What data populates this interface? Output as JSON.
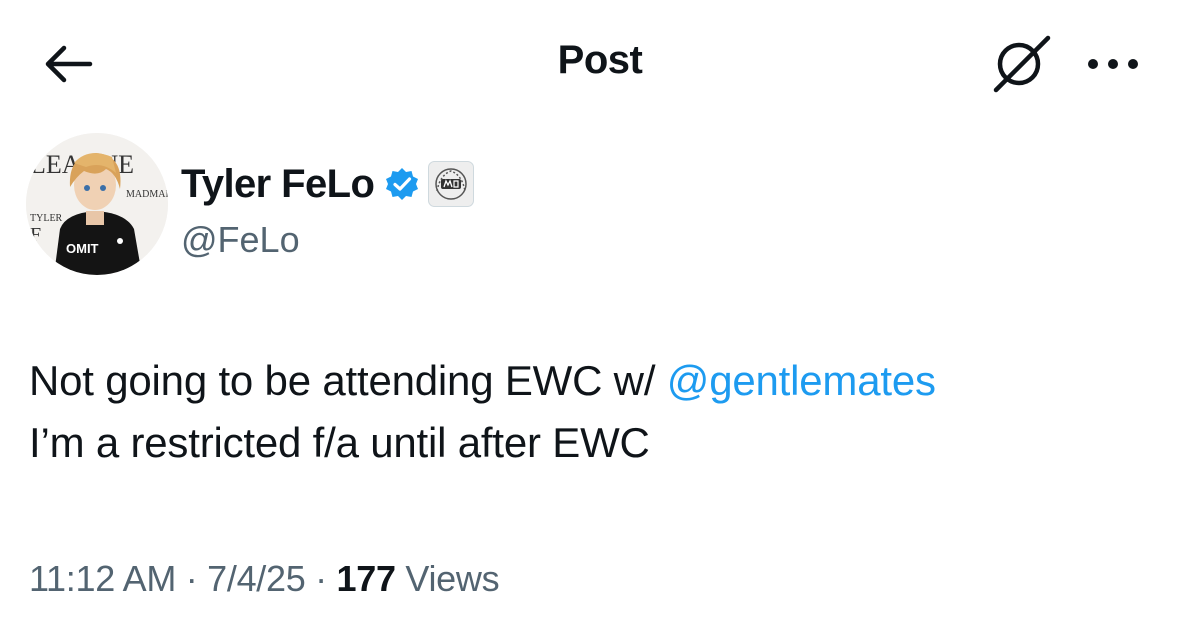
{
  "header": {
    "back_icon": "arrow-left-icon",
    "title": "Post",
    "grok_icon": "grok-icon",
    "more_icon": "more-horizontal-icon"
  },
  "author": {
    "display_name": "Tyler FeLo",
    "handle": "@FeLo",
    "verified_icon": "verified-badge-icon",
    "affiliation_badge": "team-affiliation-badge",
    "avatar_text": {
      "banner": "LEAGUE",
      "jacket": "OMIT",
      "side": "TYLER",
      "letter": "F",
      "sign": "MADMAR"
    }
  },
  "tweet": {
    "text_before_mention": "Not going to be attending EWC w/ ",
    "mention": "@gentlemates",
    "text_line2": "I’m a restricted f/a until after EWC"
  },
  "meta": {
    "time": "11:12 AM",
    "separator": " · ",
    "date": "7/4/25",
    "views_count": "177",
    "views_label": " Views"
  },
  "colors": {
    "text": "#0f1419",
    "secondary": "#536471",
    "accent": "#1d9bf0"
  }
}
